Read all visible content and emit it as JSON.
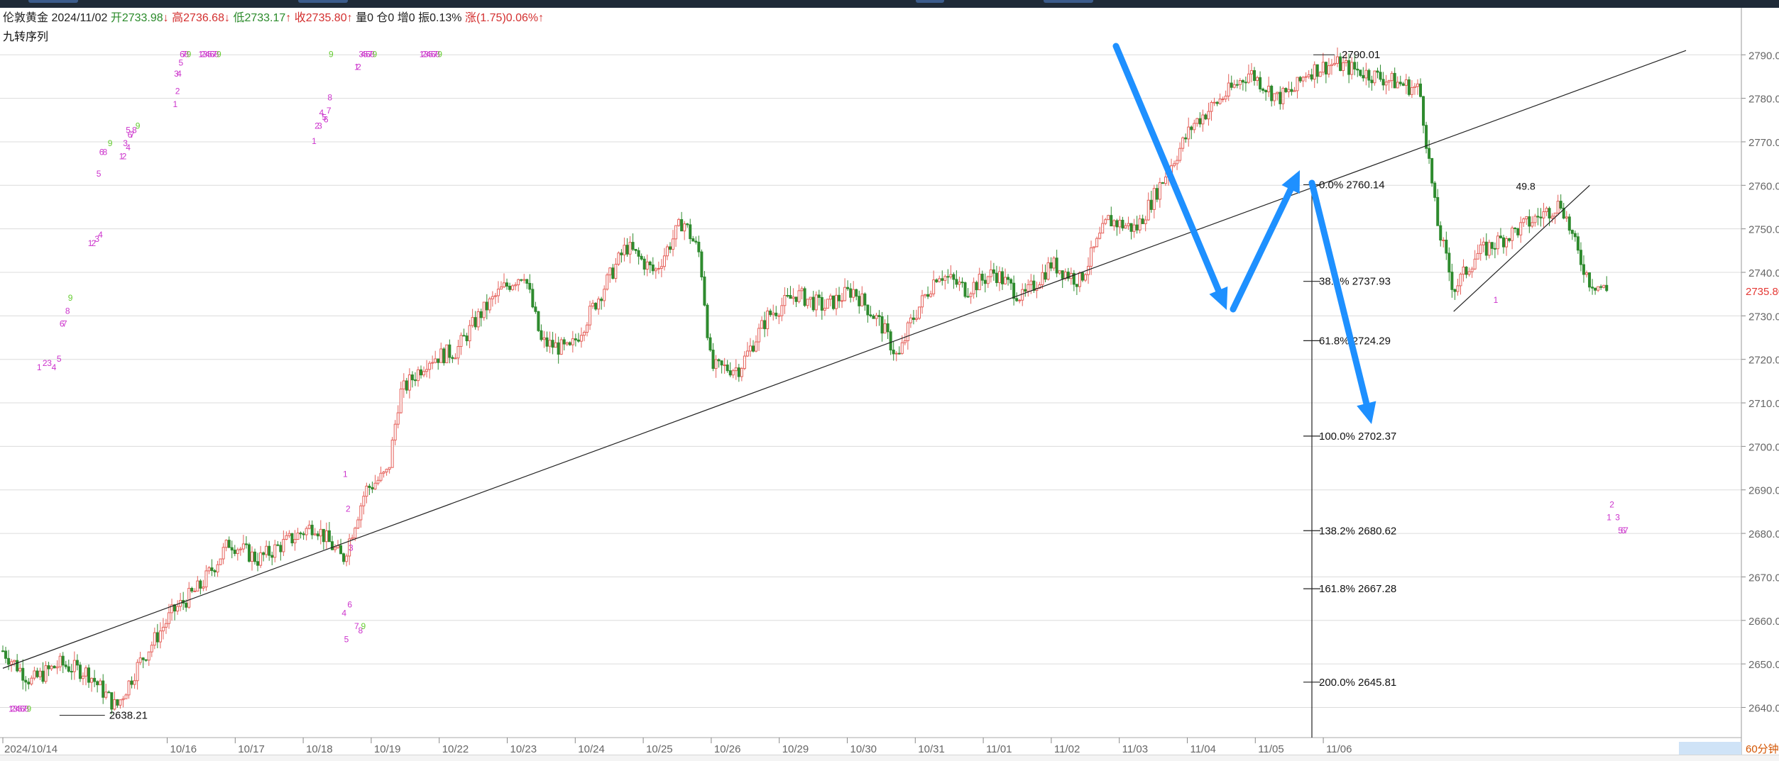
{
  "header": {
    "symbol": "伦敦黄金",
    "date": "2024/11/02",
    "open_label": "开",
    "open": "2733.98",
    "open_arrow": "↓",
    "high_label": "高",
    "high": "2736.68",
    "high_arrow": "↓",
    "low_label": "低",
    "low": "2733.17",
    "low_arrow": "↑",
    "close_label": "收",
    "close": "2735.80",
    "close_arrow": "↑",
    "volume": "量0",
    "position": "仓0",
    "increase": "增0",
    "amplitude": "振0.13%",
    "change_label": "涨",
    "change": "(1.75)",
    "change_pct": "0.06%",
    "change_arrow": "↑",
    "indicator": "九转序列",
    "period": "60分钟"
  },
  "colors": {
    "up": "#e5605a",
    "down": "#2e8b2e",
    "grid": "#dcdcdc",
    "seq_magenta": "#cc33cc",
    "seq_green": "#66cc33",
    "arrow_blue": "#1e90ff",
    "current_price": "#e53935",
    "period_badge_bg": "#cfe3f7"
  },
  "chart_data": {
    "type": "candlestick",
    "title": "",
    "x_tick_labels": [
      "2024/10/14",
      "10/16",
      "10/17",
      "10/18",
      "10/19",
      "10/22",
      "10/23",
      "10/24",
      "10/25",
      "10/26",
      "10/29",
      "10/30",
      "10/31",
      "11/01",
      "11/02",
      "11/03",
      "11/04",
      "11/05",
      "11/06"
    ],
    "y_tick_labels": [
      "2640.00",
      "2650.00",
      "2660.00",
      "2670.00",
      "2680.00",
      "2690.00",
      "2700.00",
      "2710.00",
      "2720.00",
      "2730.00",
      "2740.00",
      "2750.00",
      "2760.00",
      "2770.00",
      "2780.00",
      "2790.00"
    ],
    "ylim": [
      2636,
      2792
    ],
    "current_price": "2735.80",
    "close_path": [
      [
        0,
        2653
      ],
      [
        0.5,
        2646
      ],
      [
        1,
        2650
      ],
      [
        1.5,
        2648
      ],
      [
        2,
        2640
      ],
      [
        2.4,
        2650
      ],
      [
        3,
        2662
      ],
      [
        3.5,
        2668
      ],
      [
        4,
        2678
      ],
      [
        4.5,
        2674
      ],
      [
        5,
        2678
      ],
      [
        5.5,
        2682
      ],
      [
        6,
        2674
      ],
      [
        6.4,
        2690
      ],
      [
        6.8,
        2694
      ],
      [
        7,
        2712
      ],
      [
        7.5,
        2720
      ],
      [
        8,
        2722
      ],
      [
        8.4,
        2730
      ],
      [
        8.8,
        2736
      ],
      [
        9.2,
        2740
      ],
      [
        9.5,
        2724
      ],
      [
        10,
        2722
      ],
      [
        10.5,
        2734
      ],
      [
        11,
        2746
      ],
      [
        11.5,
        2740
      ],
      [
        12,
        2752
      ],
      [
        12.3,
        2744
      ],
      [
        12.5,
        2718
      ],
      [
        13,
        2718
      ],
      [
        13.5,
        2730
      ],
      [
        14,
        2735
      ],
      [
        14.5,
        2732
      ],
      [
        15,
        2736
      ],
      [
        15.5,
        2728
      ],
      [
        15.8,
        2720
      ],
      [
        16,
        2728
      ],
      [
        16.5,
        2740
      ],
      [
        17,
        2736
      ],
      [
        17.5,
        2740
      ],
      [
        18,
        2734
      ],
      [
        18.5,
        2742
      ],
      [
        19,
        2738
      ],
      [
        19.5,
        2752
      ],
      [
        20,
        2750
      ],
      [
        20.5,
        2762
      ],
      [
        21,
        2774
      ],
      [
        21.5,
        2780
      ],
      [
        22,
        2786
      ],
      [
        22.5,
        2780
      ],
      [
        22.8,
        2782
      ],
      [
        23,
        2786
      ],
      [
        23.5,
        2788
      ],
      [
        24,
        2786
      ],
      [
        24.5,
        2784
      ],
      [
        25,
        2782
      ],
      [
        25.3,
        2752
      ],
      [
        25.6,
        2736
      ],
      [
        26,
        2744
      ],
      [
        26.5,
        2748
      ],
      [
        27,
        2752
      ],
      [
        27.5,
        2756
      ],
      [
        27.8,
        2744
      ],
      [
        28,
        2738
      ],
      [
        28.3,
        2735.8
      ]
    ],
    "x_index_ticks": [
      0,
      2.9,
      4.1,
      5.3,
      6.5,
      7.7,
      8.9,
      10.1,
      11.3,
      12.5,
      13.7,
      14.9,
      16.1,
      17.3,
      18.5,
      19.7,
      20.9,
      22.1,
      23.3
    ],
    "trendlines": [
      {
        "from": [
          0,
          2649
        ],
        "to": [
          29.7,
          2791
        ]
      },
      {
        "from": [
          25.6,
          2731
        ],
        "to": [
          28,
          2760
        ]
      }
    ],
    "annotations": {
      "low_label": {
        "text": "2638.21",
        "x": 1.6,
        "y": 2638.21
      },
      "high_label": {
        "text": "2790.01",
        "x": 23.5,
        "y": 2790.01
      },
      "partial_fib_label": {
        "text": "49.8",
        "x": 26.7,
        "y": 2760
      }
    },
    "fibonacci": [
      {
        "label": "0.0%",
        "price": "2760.14"
      },
      {
        "label": "38.2%",
        "price": "2737.93"
      },
      {
        "label": "61.8%",
        "price": "2724.29"
      },
      {
        "label": "100.0%",
        "price": "2702.37"
      },
      {
        "label": "138.2%",
        "price": "2680.62"
      },
      {
        "label": "161.8%",
        "price": "2667.28"
      },
      {
        "label": "200.0%",
        "price": "2645.81"
      }
    ],
    "sequence_labels": [
      {
        "text": "1",
        "x": 0.6,
        "y": 2717.5,
        "c": "m"
      },
      {
        "text": "2",
        "x": 0.7,
        "y": 2718.5,
        "c": "m"
      },
      {
        "text": "3",
        "x": 0.78,
        "y": 2718.5,
        "c": "m"
      },
      {
        "text": "4",
        "x": 0.86,
        "y": 2717.5,
        "c": "m"
      },
      {
        "text": "5",
        "x": 0.95,
        "y": 2719.5,
        "c": "m"
      },
      {
        "text": "6",
        "x": 1.0,
        "y": 2727.5,
        "c": "m"
      },
      {
        "text": "7",
        "x": 1.05,
        "y": 2727.5,
        "c": "m"
      },
      {
        "text": "8",
        "x": 1.1,
        "y": 2730.5,
        "c": "m"
      },
      {
        "text": "9",
        "x": 1.15,
        "y": 2733.5,
        "c": "g"
      },
      {
        "text": "1",
        "x": 1.5,
        "y": 2746,
        "c": "m"
      },
      {
        "text": "2",
        "x": 1.56,
        "y": 2746,
        "c": "m"
      },
      {
        "text": "3",
        "x": 1.62,
        "y": 2747,
        "c": "m"
      },
      {
        "text": "4",
        "x": 1.68,
        "y": 2748,
        "c": "m"
      },
      {
        "text": "5",
        "x": 1.65,
        "y": 2762,
        "c": "m"
      },
      {
        "text": "6",
        "x": 1.7,
        "y": 2767,
        "c": "m"
      },
      {
        "text": "8",
        "x": 1.76,
        "y": 2767,
        "c": "m"
      },
      {
        "text": "9",
        "x": 1.85,
        "y": 2769,
        "c": "g"
      },
      {
        "text": "1",
        "x": 2.05,
        "y": 2766,
        "c": "m"
      },
      {
        "text": "2",
        "x": 2.1,
        "y": 2766,
        "c": "m"
      },
      {
        "text": "3",
        "x": 2.12,
        "y": 2769,
        "c": "m"
      },
      {
        "text": "4",
        "x": 2.17,
        "y": 2768,
        "c": "m"
      },
      {
        "text": "5",
        "x": 2.17,
        "y": 2772,
        "c": "m"
      },
      {
        "text": "6",
        "x": 2.2,
        "y": 2771,
        "c": "m"
      },
      {
        "text": "7",
        "x": 2.24,
        "y": 2771,
        "c": "m"
      },
      {
        "text": "8",
        "x": 2.28,
        "y": 2772,
        "c": "m"
      },
      {
        "text": "9",
        "x": 2.34,
        "y": 2773,
        "c": "g"
      },
      {
        "text": "1",
        "x": 3.0,
        "y": 2778,
        "c": "m"
      },
      {
        "text": "2",
        "x": 3.04,
        "y": 2781,
        "c": "m"
      },
      {
        "text": "3",
        "x": 3.02,
        "y": 2785,
        "c": "m"
      },
      {
        "text": "4",
        "x": 3.07,
        "y": 2785,
        "c": "m"
      },
      {
        "text": "5",
        "x": 3.1,
        "y": 2787.5,
        "c": "m"
      },
      {
        "text": "6",
        "x": 3.12,
        "y": 2789.5,
        "c": "m"
      },
      {
        "text": "7",
        "x": 3.16,
        "y": 2789.5,
        "c": "m"
      },
      {
        "text": "8",
        "x": 3.2,
        "y": 2789.5,
        "c": "m"
      },
      {
        "text": "9",
        "x": 3.24,
        "y": 2789.5,
        "c": "g"
      },
      {
        "text": "1",
        "x": 3.45,
        "y": 2789.5,
        "c": "m"
      },
      {
        "text": "2",
        "x": 3.49,
        "y": 2789.5,
        "c": "m"
      },
      {
        "text": "3",
        "x": 3.53,
        "y": 2789.5,
        "c": "m"
      },
      {
        "text": "4",
        "x": 3.57,
        "y": 2789.5,
        "c": "m"
      },
      {
        "text": "5",
        "x": 3.61,
        "y": 2789.5,
        "c": "m"
      },
      {
        "text": "6",
        "x": 3.65,
        "y": 2789.5,
        "c": "m"
      },
      {
        "text": "7",
        "x": 3.69,
        "y": 2789.5,
        "c": "m"
      },
      {
        "text": "8",
        "x": 3.73,
        "y": 2789.5,
        "c": "m"
      },
      {
        "text": "9",
        "x": 3.77,
        "y": 2789.5,
        "c": "g"
      },
      {
        "text": "1",
        "x": 5.45,
        "y": 2769.5,
        "c": "m"
      },
      {
        "text": "2",
        "x": 5.5,
        "y": 2773,
        "c": "m"
      },
      {
        "text": "3",
        "x": 5.55,
        "y": 2773,
        "c": "m"
      },
      {
        "text": "4",
        "x": 5.58,
        "y": 2776,
        "c": "m"
      },
      {
        "text": "5",
        "x": 5.63,
        "y": 2775,
        "c": "m"
      },
      {
        "text": "6",
        "x": 5.66,
        "y": 2774.5,
        "c": "m"
      },
      {
        "text": "7",
        "x": 5.71,
        "y": 2776.5,
        "c": "m"
      },
      {
        "text": "8",
        "x": 5.73,
        "y": 2779.5,
        "c": "m"
      },
      {
        "text": "9",
        "x": 5.75,
        "y": 2789.5,
        "c": "g"
      },
      {
        "text": "1",
        "x": 6.2,
        "y": 2786.5,
        "c": "m"
      },
      {
        "text": "2",
        "x": 6.24,
        "y": 2786.5,
        "c": "m"
      },
      {
        "text": "3",
        "x": 6.28,
        "y": 2789.5,
        "c": "m"
      },
      {
        "text": "4",
        "x": 6.32,
        "y": 2789.5,
        "c": "m"
      },
      {
        "text": "5",
        "x": 6.36,
        "y": 2789.5,
        "c": "m"
      },
      {
        "text": "6",
        "x": 6.4,
        "y": 2789.5,
        "c": "m"
      },
      {
        "text": "7",
        "x": 6.44,
        "y": 2789.5,
        "c": "m"
      },
      {
        "text": "8",
        "x": 6.48,
        "y": 2789.5,
        "c": "m"
      },
      {
        "text": "9",
        "x": 6.52,
        "y": 2789.5,
        "c": "g"
      },
      {
        "text": "1",
        "x": 7.35,
        "y": 2789.5,
        "c": "m"
      },
      {
        "text": "2",
        "x": 7.39,
        "y": 2789.5,
        "c": "m"
      },
      {
        "text": "3",
        "x": 7.43,
        "y": 2789.5,
        "c": "m"
      },
      {
        "text": "4",
        "x": 7.47,
        "y": 2789.5,
        "c": "m"
      },
      {
        "text": "5",
        "x": 7.51,
        "y": 2789.5,
        "c": "m"
      },
      {
        "text": "6",
        "x": 7.55,
        "y": 2789.5,
        "c": "m"
      },
      {
        "text": "7",
        "x": 7.59,
        "y": 2789.5,
        "c": "m"
      },
      {
        "text": "8",
        "x": 7.63,
        "y": 2789.5,
        "c": "m"
      },
      {
        "text": "9",
        "x": 7.67,
        "y": 2789.5,
        "c": "g"
      },
      {
        "text": "1",
        "x": 6.0,
        "y": 2693,
        "c": "m"
      },
      {
        "text": "2",
        "x": 6.05,
        "y": 2685,
        "c": "m"
      },
      {
        "text": "3",
        "x": 6.1,
        "y": 2676,
        "c": "m"
      },
      {
        "text": "4",
        "x": 5.98,
        "y": 2661,
        "c": "m"
      },
      {
        "text": "6",
        "x": 6.08,
        "y": 2663,
        "c": "m"
      },
      {
        "text": "7",
        "x": 6.2,
        "y": 2658,
        "c": "m"
      },
      {
        "text": "8",
        "x": 6.27,
        "y": 2657,
        "c": "m"
      },
      {
        "text": "9",
        "x": 6.32,
        "y": 2658,
        "c": "g"
      },
      {
        "text": "5",
        "x": 6.02,
        "y": 2655,
        "c": "m"
      },
      {
        "text": "1",
        "x": 0.1,
        "y": 2639,
        "c": "m"
      },
      {
        "text": "2",
        "x": 0.14,
        "y": 2639,
        "c": "m"
      },
      {
        "text": "3",
        "x": 0.18,
        "y": 2639,
        "c": "m"
      },
      {
        "text": "4",
        "x": 0.22,
        "y": 2639,
        "c": "m"
      },
      {
        "text": "5",
        "x": 0.26,
        "y": 2639,
        "c": "m"
      },
      {
        "text": "6",
        "x": 0.3,
        "y": 2639,
        "c": "m"
      },
      {
        "text": "7",
        "x": 0.34,
        "y": 2639,
        "c": "m"
      },
      {
        "text": "8",
        "x": 0.38,
        "y": 2639,
        "c": "m"
      },
      {
        "text": "9",
        "x": 0.42,
        "y": 2639,
        "c": "g"
      },
      {
        "text": "1",
        "x": 28.3,
        "y": 2683,
        "c": "m"
      },
      {
        "text": "2",
        "x": 28.35,
        "y": 2686,
        "c": "m"
      },
      {
        "text": "3",
        "x": 28.45,
        "y": 2683,
        "c": "m"
      },
      {
        "text": "5",
        "x": 28.5,
        "y": 2680,
        "c": "m"
      },
      {
        "text": "6",
        "x": 28.55,
        "y": 2680,
        "c": "m"
      },
      {
        "text": "7",
        "x": 28.6,
        "y": 2680,
        "c": "m"
      },
      {
        "text": "1",
        "x": 26.3,
        "y": 2733,
        "c": "m"
      }
    ]
  }
}
